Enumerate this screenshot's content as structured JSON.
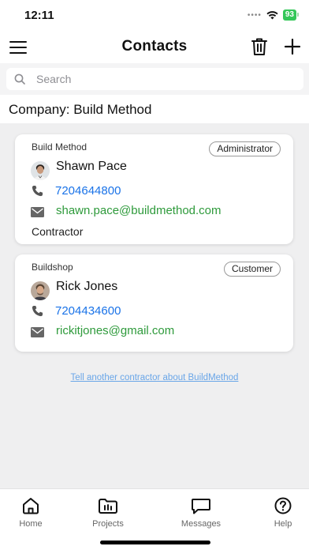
{
  "status": {
    "time": "12:11",
    "battery": "93"
  },
  "nav": {
    "title": "Contacts",
    "menu_icon": "hamburger-menu-icon",
    "delete_icon": "trash-icon",
    "add_icon": "plus-icon"
  },
  "search": {
    "placeholder": "Search",
    "value": ""
  },
  "company": {
    "title": "Company: Build Method"
  },
  "contacts": [
    {
      "company": "Build Method",
      "role": "Administrator",
      "name": "Shawn Pace",
      "phone": "7204644800",
      "email": "shawn.pace@buildmethod.com",
      "type": "Contractor"
    },
    {
      "company": "Buildshop",
      "role": "Customer",
      "name": "Rick Jones",
      "phone": "7204434600",
      "email": "rickitjones@gmail.com"
    }
  ],
  "invite_link": "Tell another contractor about BuildMethod",
  "tabs": [
    {
      "label": "Home",
      "icon": "home-icon"
    },
    {
      "label": "Projects",
      "icon": "projects-icon"
    },
    {
      "label": "Messages",
      "icon": "messages-icon"
    },
    {
      "label": "Help",
      "icon": "help-icon"
    }
  ],
  "colors": {
    "link_blue": "#1a73e8",
    "email_green": "#2e9a3b",
    "battery_green": "#34c759"
  }
}
